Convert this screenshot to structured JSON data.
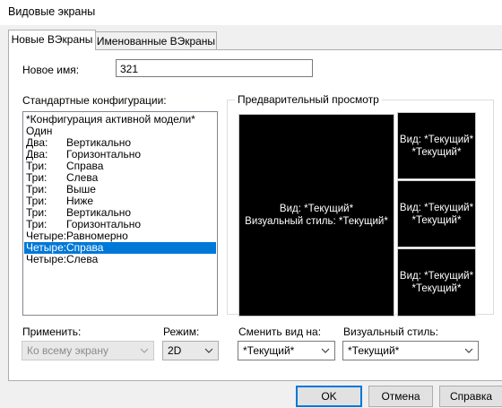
{
  "window": {
    "title": "Видовые экраны"
  },
  "tabs": [
    {
      "label": "Новые ВЭкраны",
      "active": true
    },
    {
      "label": "Именованные ВЭкраны",
      "active": false
    }
  ],
  "new_name": {
    "label": "Новое имя:",
    "value": "321"
  },
  "configs": {
    "label": "Стандартные конфигурации:",
    "items": [
      {
        "c1": "*Конфигурация активной модели*",
        "c2": ""
      },
      {
        "c1": "Один",
        "c2": ""
      },
      {
        "c1": "Два:",
        "c2": "Вертикально"
      },
      {
        "c1": "Два:",
        "c2": "Горизонтально"
      },
      {
        "c1": "Три:",
        "c2": "Справа"
      },
      {
        "c1": "Три:",
        "c2": "Слева"
      },
      {
        "c1": "Три:",
        "c2": "Выше"
      },
      {
        "c1": "Три:",
        "c2": "Ниже"
      },
      {
        "c1": "Три:",
        "c2": "Вертикально"
      },
      {
        "c1": "Три:",
        "c2": "Горизонтально"
      },
      {
        "c1": "Четыре:",
        "c2": "Равномерно"
      },
      {
        "c1": "Четыре:",
        "c2": "Справа",
        "selected": true
      },
      {
        "c1": "Четыре:",
        "c2": "Слева"
      }
    ]
  },
  "preview": {
    "label": "Предварительный просмотр",
    "main": {
      "line1": "Вид: *Текущий*",
      "line2": "Визуальный стиль: *Текущий*"
    },
    "small": [
      {
        "line1": "Вид: *Текущий*",
        "line2": "*Текущий*"
      },
      {
        "line1": "Вид: *Текущий*",
        "line2": "*Текущий*"
      },
      {
        "line1": "Вид: *Текущий*",
        "line2": "*Текущий*"
      }
    ]
  },
  "apply": {
    "label": "Применить:",
    "value": "Ко всему экрану"
  },
  "mode": {
    "label": "Режим:",
    "value": "2D"
  },
  "change_view": {
    "label": "Сменить вид на:",
    "value": "*Текущий*"
  },
  "visual_style": {
    "label": "Визуальный стиль:",
    "value": "*Текущий*"
  },
  "buttons": {
    "ok": "OK",
    "cancel": "Отмена",
    "help": "Справка"
  },
  "colors": {
    "selection": "#0078d7",
    "viewport_bg": "#000000"
  }
}
